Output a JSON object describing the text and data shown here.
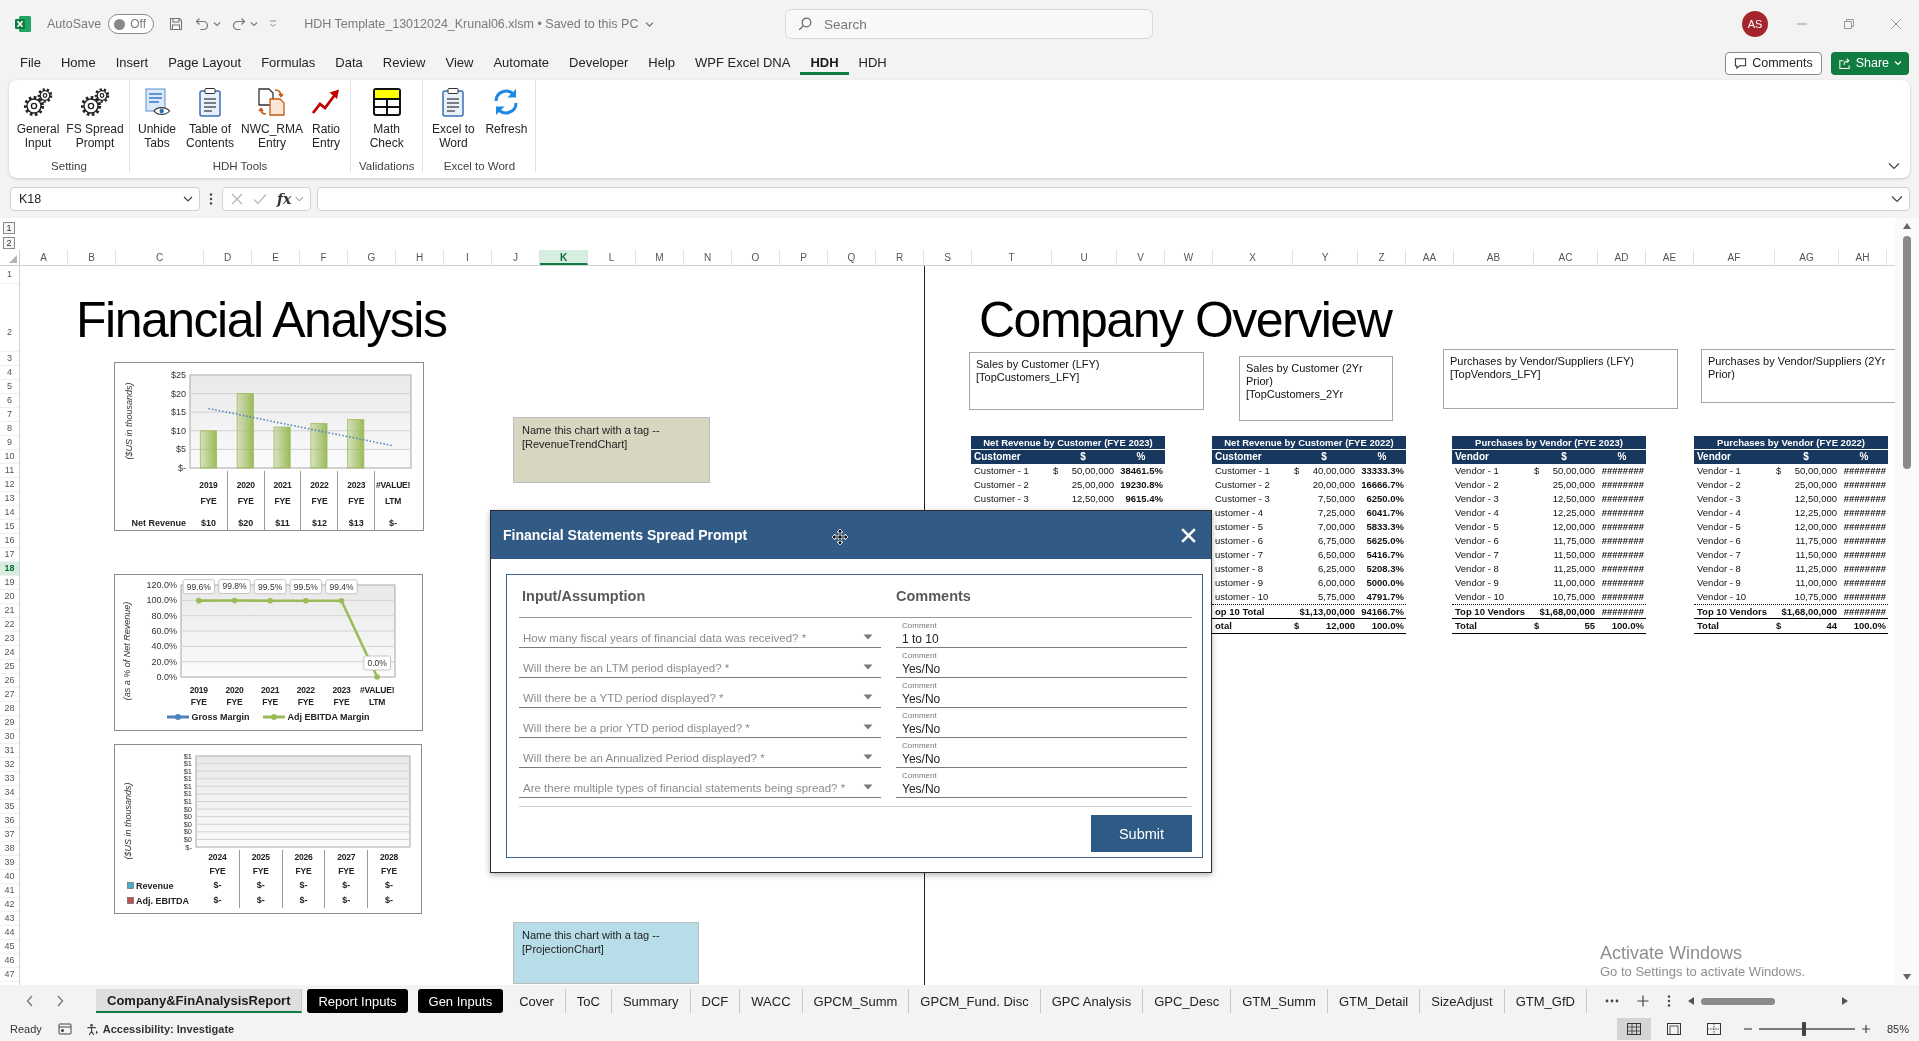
{
  "title_bar": {
    "autosave_label": "AutoSave",
    "autosave": {
      "on": false,
      "label": "Off"
    },
    "document_title": "HDH Template_13012024_Krunal06.xlsm • Saved to this PC",
    "search": {
      "placeholder": "Search"
    },
    "user_initials": "AS"
  },
  "ribbon_tabs": [
    {
      "label": "File",
      "selected": false
    },
    {
      "label": "Home",
      "selected": false
    },
    {
      "label": "Insert",
      "selected": false
    },
    {
      "label": "Page Layout",
      "selected": false
    },
    {
      "label": "Formulas",
      "selected": false
    },
    {
      "label": "Data",
      "selected": false
    },
    {
      "label": "Review",
      "selected": false
    },
    {
      "label": "View",
      "selected": false
    },
    {
      "label": "Automate",
      "selected": false
    },
    {
      "label": "Developer",
      "selected": false
    },
    {
      "label": "Help",
      "selected": false
    },
    {
      "label": "WPF Excel DNA",
      "selected": false
    },
    {
      "label": "HDH",
      "selected": true
    },
    {
      "label": "HDH",
      "selected": false
    }
  ],
  "header_buttons": {
    "comments": "Comments",
    "share": "Share"
  },
  "ribbon_groups": [
    {
      "label": "Setting",
      "buttons": [
        {
          "label": "General Input",
          "kind": "gears"
        },
        {
          "label": "FS Spread Prompt",
          "kind": "gears"
        }
      ]
    },
    {
      "label": "HDH Tools",
      "buttons": [
        {
          "label": "Unhide Tabs",
          "kind": "document-eye"
        },
        {
          "label": "Table of Contents",
          "kind": "clipboard"
        },
        {
          "label": "NWC_RMA Entry",
          "kind": "documents-arrows"
        },
        {
          "label": "Ratio Entry",
          "kind": "trend-arrow"
        }
      ]
    },
    {
      "label": "Validations",
      "buttons": [
        {
          "label": "Math Check",
          "kind": "grid"
        }
      ]
    },
    {
      "label": "Excel to Word",
      "buttons": [
        {
          "label": "Excel to Word",
          "kind": "clipboard"
        },
        {
          "label": "Refresh",
          "kind": "refresh"
        }
      ]
    }
  ],
  "formula_bar": {
    "name_box": "K18",
    "function_label": "fx"
  },
  "outline_levels": [
    "1",
    "2"
  ],
  "columns": [
    {
      "label": "A",
      "selected": false
    },
    {
      "label": "B",
      "selected": false
    },
    {
      "label": "C",
      "selected": false
    },
    {
      "label": "D",
      "selected": false
    },
    {
      "label": "E",
      "selected": false
    },
    {
      "label": "F",
      "selected": false
    },
    {
      "label": "G",
      "selected": false
    },
    {
      "label": "H",
      "selected": false
    },
    {
      "label": "I",
      "selected": false
    },
    {
      "label": "J",
      "selected": false
    },
    {
      "label": "K",
      "selected": true
    },
    {
      "label": "L",
      "selected": false
    },
    {
      "label": "M",
      "selected": false
    },
    {
      "label": "N",
      "selected": false
    },
    {
      "label": "O",
      "selected": false
    },
    {
      "label": "P",
      "selected": false
    },
    {
      "label": "Q",
      "selected": false
    },
    {
      "label": "R",
      "selected": false
    },
    {
      "label": "S",
      "selected": false
    },
    {
      "label": "T",
      "selected": false
    },
    {
      "label": "U",
      "selected": false
    },
    {
      "label": "V",
      "selected": false
    },
    {
      "label": "W",
      "selected": false
    },
    {
      "label": "X",
      "selected": false
    },
    {
      "label": "Y",
      "selected": false
    },
    {
      "label": "Z",
      "selected": false
    },
    {
      "label": "AA",
      "selected": false
    },
    {
      "label": "AB",
      "selected": false
    },
    {
      "label": "AC",
      "selected": false
    },
    {
      "label": "AD",
      "selected": false
    },
    {
      "label": "AE",
      "selected": false
    },
    {
      "label": "AF",
      "selected": false
    },
    {
      "label": "AG",
      "selected": false
    },
    {
      "label": "AH",
      "selected": false
    }
  ],
  "rows": [
    {
      "label": "1",
      "selected": false
    },
    {
      "label": "2",
      "selected": false
    },
    {
      "label": "3",
      "selected": false
    },
    {
      "label": "4",
      "selected": false
    },
    {
      "label": "5",
      "selected": false
    },
    {
      "label": "6",
      "selected": false
    },
    {
      "label": "7",
      "selected": false
    },
    {
      "label": "8",
      "selected": false
    },
    {
      "label": "9",
      "selected": false
    },
    {
      "label": "10",
      "selected": false
    },
    {
      "label": "11",
      "selected": false
    },
    {
      "label": "12",
      "selected": false
    },
    {
      "label": "13",
      "selected": false
    },
    {
      "label": "14",
      "selected": false
    },
    {
      "label": "15",
      "selected": false
    },
    {
      "label": "16",
      "selected": false
    },
    {
      "label": "17",
      "selected": false
    },
    {
      "label": "18",
      "selected": true
    },
    {
      "label": "19",
      "selected": false
    },
    {
      "label": "20",
      "selected": false
    },
    {
      "label": "21",
      "selected": false
    },
    {
      "label": "22",
      "selected": false
    },
    {
      "label": "23",
      "selected": false
    },
    {
      "label": "24",
      "selected": false
    },
    {
      "label": "25",
      "selected": false
    },
    {
      "label": "26",
      "selected": false
    },
    {
      "label": "27",
      "selected": false
    },
    {
      "label": "28",
      "selected": false
    },
    {
      "label": "29",
      "selected": false
    },
    {
      "label": "30",
      "selected": false
    },
    {
      "label": "31",
      "selected": false
    },
    {
      "label": "32",
      "selected": false
    },
    {
      "label": "33",
      "selected": false
    },
    {
      "label": "34",
      "selected": false
    },
    {
      "label": "35",
      "selected": false
    },
    {
      "label": "36",
      "selected": false
    },
    {
      "label": "37",
      "selected": false
    },
    {
      "label": "38",
      "selected": false
    },
    {
      "label": "39",
      "selected": false
    },
    {
      "label": "40",
      "selected": false
    },
    {
      "label": "41",
      "selected": false
    },
    {
      "label": "42",
      "selected": false
    },
    {
      "label": "43",
      "selected": false
    },
    {
      "label": "44",
      "selected": false
    },
    {
      "label": "45",
      "selected": false
    },
    {
      "label": "46",
      "selected": false
    },
    {
      "label": "47",
      "selected": false
    }
  ],
  "sheet": {
    "left_title": "Financial Analysis",
    "right_title": "Company Overview",
    "charts": [
      {
        "chart_data": {
          "type": "bar",
          "ylabel": "($US in thousands)",
          "categories": [
            "2019 FYE",
            "2020 FYE",
            "2021 FYE",
            "2022 FYE",
            "2023 FYE",
            "#VALUE! LTM"
          ],
          "series": [
            {
              "name": "Net Revenue",
              "color": "#9bbb59",
              "values": [
                10,
                20,
                11,
                12,
                13,
                0
              ],
              "value_labels": [
                "$10",
                "$20",
                "$11",
                "$12",
                "$13",
                "$-"
              ]
            },
            {
              "type": "line",
              "color": "#4f81bd",
              "values": [
                16,
                14,
                12,
                10,
                8,
                6
              ],
              "line_style": "dotted"
            }
          ],
          "ylim": [
            0,
            25
          ],
          "yticks": [
            {
              "value": 0,
              "label": "$-"
            },
            {
              "value": 5,
              "label": "$5"
            },
            {
              "value": 10,
              "label": "$10"
            },
            {
              "value": 15,
              "label": "$15"
            },
            {
              "value": 20,
              "label": "$20"
            },
            {
              "value": 25,
              "label": "$25"
            }
          ],
          "grid": true
        }
      },
      {
        "chart_data": {
          "type": "line",
          "ylabel": "(as a % of  Net Revenue)",
          "categories": [
            "2019 FYE",
            "2020 FYE",
            "2021 FYE",
            "2022 FYE",
            "2023 FYE",
            "#VALUE! LTM"
          ],
          "series": [
            {
              "name": "Gross Margin",
              "color": "#4f81bd",
              "values": [
                null,
                null,
                null,
                null,
                null,
                null
              ]
            },
            {
              "name": "Adj EBITDA Margin",
              "color": "#9bbb59",
              "values": [
                99.6,
                99.8,
                99.5,
                99.5,
                99.4,
                0
              ],
              "value_labels": [
                "99.6%",
                "99.8%",
                "99.5%",
                "99.5%",
                "99.4%",
                "0.0%"
              ]
            }
          ],
          "ylim": [
            0,
            120
          ],
          "yticks": [
            {
              "value": 0,
              "label": "0.0%"
            },
            {
              "value": 20,
              "label": "20.0%"
            },
            {
              "value": 40,
              "label": "40.0%"
            },
            {
              "value": 60,
              "label": "60.0%"
            },
            {
              "value": 80,
              "label": "80.0%"
            },
            {
              "value": 100,
              "label": "100.0%"
            },
            {
              "value": 120,
              "label": "120.0%"
            }
          ],
          "grid": true,
          "legend": "bottom"
        }
      },
      {
        "chart_data": {
          "type": "bar",
          "ylabel": "($US in thousands)",
          "categories": [
            "2024 FYE",
            "2025 FYE",
            "2026 FYE",
            "2027 FYE",
            "2028 FYE"
          ],
          "series": [
            {
              "name": "Revenue",
              "color": "#4bacc6",
              "values": [
                0,
                0,
                0,
                0,
                0
              ],
              "value_labels": [
                "$-",
                "$-",
                "$-",
                "$-",
                "$-"
              ]
            },
            {
              "name": "Adj. EBITDA",
              "color": "#c0504d",
              "values": [
                0,
                0,
                0,
                0,
                0
              ],
              "value_labels": [
                "$-",
                "$-",
                "$-",
                "$-",
                "$-"
              ]
            }
          ],
          "ylim": [
            0,
            1.2
          ],
          "yticks": [
            {
              "value": 0,
              "label": "$-"
            },
            {
              "value": 0.1,
              "label": "$0"
            },
            {
              "value": 0.2,
              "label": "$0"
            },
            {
              "value": 0.3,
              "label": "$0"
            },
            {
              "value": 0.4,
              "label": "$0"
            },
            {
              "value": 0.5,
              "label": "$0"
            },
            {
              "value": 0.6,
              "label": "$1"
            },
            {
              "value": 0.7,
              "label": "$1"
            },
            {
              "value": 0.8,
              "label": "$1"
            },
            {
              "value": 0.9,
              "label": "$1"
            },
            {
              "value": 1.0,
              "label": "$1"
            },
            {
              "value": 1.1,
              "label": "$1"
            },
            {
              "value": 1.2,
              "label": "$1"
            }
          ],
          "grid": true
        }
      }
    ],
    "tag_notes": [
      {
        "text": "Name this chart with a tag --",
        "tag": "[RevenueTrendChart]",
        "color": "#d8d6c1"
      },
      {
        "text": "Name this chart with a tag --",
        "tag": "[ProjectionChart]",
        "color": "#b7dee8"
      }
    ],
    "overview_notes": [
      {
        "text": "Sales by Customer (LFY)",
        "tag": "[TopCustomers_LFY]"
      },
      {
        "text": "Sales by Customer (2Yr Prior)",
        "tag": "[TopCustomers_2Yr"
      },
      {
        "text": "Purchases by Vendor/Suppliers (LFY)",
        "tag": "[TopVendors_LFY]"
      },
      {
        "text": "Purchases by Vendor/Suppliers (2Yr Prior)"
      }
    ],
    "tables": [
      {
        "title": "Net Revenue by Customer (FYE 2023)",
        "columns": [
          "Customer",
          "$",
          "%"
        ],
        "rows": [
          {
            "label": "Customer - 1",
            "currency": "$",
            "amount": "50,00,000",
            "percent": "38461.5%"
          },
          {
            "label": "Customer - 2",
            "amount": "25,00,000",
            "percent": "19230.8%"
          },
          {
            "label": "Customer - 3",
            "amount": "12,50,000",
            "percent": "9615.4%"
          }
        ]
      },
      {
        "title": "Net Revenue by Customer (FYE 2022)",
        "columns": [
          "Customer",
          "$",
          "%"
        ],
        "rows": [
          {
            "label": "Customer - 1",
            "currency": "$",
            "amount": "40,00,000",
            "percent": "33333.3%"
          },
          {
            "label": "Customer - 2",
            "amount": "20,00,000",
            "percent": "16666.7%"
          },
          {
            "label": "Customer - 3",
            "amount": "7,50,000",
            "percent": "6250.0%"
          },
          {
            "label": "ustomer - 4",
            "amount": "7,25,000",
            "percent": "6041.7%"
          },
          {
            "label": "ustomer - 5",
            "amount": "7,00,000",
            "percent": "5833.3%"
          },
          {
            "label": "ustomer - 6",
            "amount": "6,75,000",
            "percent": "5625.0%"
          },
          {
            "label": "ustomer - 7",
            "amount": "6,50,000",
            "percent": "5416.7%"
          },
          {
            "label": "ustomer - 8",
            "amount": "6,25,000",
            "percent": "5208.3%"
          },
          {
            "label": "ustomer - 9",
            "amount": "6,00,000",
            "percent": "5000.0%"
          },
          {
            "label": "ustomer - 10",
            "amount": "5,75,000",
            "percent": "4791.7%"
          }
        ],
        "subtotal": {
          "label": "op 10 Total",
          "amount": "$1,13,00,000",
          "percent": "94166.7%"
        },
        "total": {
          "label": "otal",
          "currency": "$",
          "amount": "12,000",
          "percent": "100.0%"
        }
      },
      {
        "title": "Purchases by Vendor (FYE 2023)",
        "columns": [
          "Vendor",
          "$",
          "%"
        ],
        "rows": [
          {
            "label": "Vendor - 1",
            "currency": "$",
            "amount": "50,00,000",
            "percent": "########"
          },
          {
            "label": "Vendor - 2",
            "amount": "25,00,000",
            "percent": "########"
          },
          {
            "label": "Vendor - 3",
            "amount": "12,50,000",
            "percent": "########"
          },
          {
            "label": "Vendor - 4",
            "amount": "12,25,000",
            "percent": "########"
          },
          {
            "label": "Vendor - 5",
            "amount": "12,00,000",
            "percent": "########"
          },
          {
            "label": "Vendor - 6",
            "amount": "11,75,000",
            "percent": "########"
          },
          {
            "label": "Vendor - 7",
            "amount": "11,50,000",
            "percent": "########"
          },
          {
            "label": "Vendor - 8",
            "amount": "11,25,000",
            "percent": "########"
          },
          {
            "label": "Vendor - 9",
            "amount": "11,00,000",
            "percent": "########"
          },
          {
            "label": "Vendor - 10",
            "amount": "10,75,000",
            "percent": "########"
          }
        ],
        "subtotal": {
          "label": "Top 10 Vendors",
          "amount": "$1,68,00,000",
          "percent": "########"
        },
        "total": {
          "label": "Total",
          "currency": "$",
          "amount": "55",
          "percent": "100.0%"
        }
      },
      {
        "title": "Purchases by Vendor (FYE 2022)",
        "columns": [
          "Vendor",
          "$",
          "%"
        ],
        "rows": [
          {
            "label": "Vendor - 1",
            "currency": "$",
            "amount": "50,00,000",
            "percent": "########"
          },
          {
            "label": "Vendor - 2",
            "amount": "25,00,000",
            "percent": "########"
          },
          {
            "label": "Vendor - 3",
            "amount": "12,50,000",
            "percent": "########"
          },
          {
            "label": "Vendor - 4",
            "amount": "12,25,000",
            "percent": "########"
          },
          {
            "label": "Vendor - 5",
            "amount": "12,00,000",
            "percent": "########"
          },
          {
            "label": "Vendor - 6",
            "amount": "11,75,000",
            "percent": "########"
          },
          {
            "label": "Vendor - 7",
            "amount": "11,50,000",
            "percent": "########"
          },
          {
            "label": "Vendor - 8",
            "amount": "11,25,000",
            "percent": "########"
          },
          {
            "label": "Vendor - 9",
            "amount": "11,00,000",
            "percent": "########"
          },
          {
            "label": "Vendor - 10",
            "amount": "10,75,000",
            "percent": "########"
          }
        ],
        "subtotal": {
          "label": "Top 10 Vendors",
          "amount": "$1,68,00,000",
          "percent": "########"
        },
        "total": {
          "label": "Total",
          "currency": "$",
          "amount": "44",
          "percent": "100.0%"
        }
      }
    ]
  },
  "dialog": {
    "title": "Financial Statements Spread Prompt",
    "columns": [
      "Input/Assumption",
      "Comments"
    ],
    "questions": [
      {
        "placeholder": "How many fiscal years of financial data was received? *",
        "comment_label": "Comment",
        "comment": "1 to 10"
      },
      {
        "placeholder": "Will there be an LTM period displayed? *",
        "comment_label": "Comment",
        "comment": "Yes/No"
      },
      {
        "placeholder": "Will there be a YTD period displayed? *",
        "comment_label": "Comment",
        "comment": "Yes/No"
      },
      {
        "placeholder": "Will there be a prior YTD period displayed? *",
        "comment_label": "Comment",
        "comment": "Yes/No"
      },
      {
        "placeholder": "Will there be an Annualized Period displayed? *",
        "comment_label": "Comment",
        "comment": "Yes/No"
      },
      {
        "placeholder": "Are there multiple types of financial statements being spread? *",
        "comment_label": "Comment",
        "comment": "Yes/No"
      }
    ],
    "submit": "Submit"
  },
  "sheet_tabs": [
    {
      "label": "Company&FinAnalysisReport",
      "selected": true
    },
    {
      "label": "Report Inputs",
      "selected": false,
      "color": "#000000"
    },
    {
      "label": "Gen Inputs",
      "selected": false,
      "color": "#000000"
    },
    {
      "label": "Cover",
      "selected": false
    },
    {
      "label": "ToC",
      "selected": false
    },
    {
      "label": "Summary",
      "selected": false
    },
    {
      "label": "DCF",
      "selected": false
    },
    {
      "label": "WACC",
      "selected": false
    },
    {
      "label": "GPCM_Summ",
      "selected": false
    },
    {
      "label": "GPCM_Fund. Disc",
      "selected": false
    },
    {
      "label": "GPC Analysis",
      "selected": false
    },
    {
      "label": "GPC_Desc",
      "selected": false
    },
    {
      "label": "GTM_Summ",
      "selected": false
    },
    {
      "label": "GTM_Detail",
      "selected": false
    },
    {
      "label": "SizeAdjust",
      "selected": false
    },
    {
      "label": "GTM_GfD",
      "selected": false
    }
  ],
  "status_bar": {
    "status": "Ready",
    "accessibility": "Accessibility: Investigate",
    "views": [
      {
        "kind": "normal",
        "selected": true
      },
      {
        "kind": "page-layout",
        "selected": false
      },
      {
        "kind": "page-break-preview",
        "selected": false
      }
    ],
    "zoom": {
      "level": 0.47,
      "label": "85%"
    }
  },
  "activation_notice": {
    "title": "Activate Windows",
    "text": "Go to Settings to activate Windows."
  }
}
